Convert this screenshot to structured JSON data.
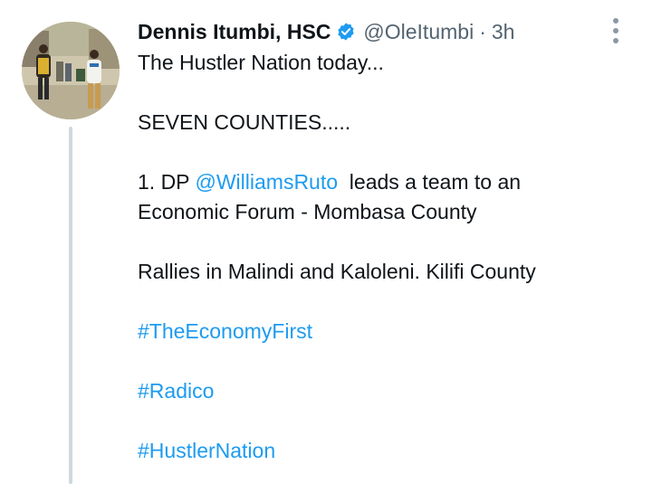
{
  "author": {
    "display_name": "Dennis Itumbi, HSC",
    "handle": "@OleItumbi",
    "separator": "·",
    "time": "3h",
    "verified": true
  },
  "text": {
    "line1": "The Hustler Nation today...",
    "line2": "SEVEN COUNTIES.....",
    "line3_prefix": "1. DP ",
    "line3_mention": "@WilliamsRuto",
    "line3_suffix": "  leads a team to an",
    "line4": "Economic Forum - Mombasa County",
    "line5": "Rallies in Malindi and Kaloleni. Kilifi County",
    "hashtag1": "#TheEconomyFirst",
    "hashtag2": "#Radico",
    "hashtag3": "#HustlerNation"
  },
  "colors": {
    "link": "#1d9bf0",
    "secondary_text": "#536471",
    "thread_line": "#cfd9de"
  },
  "icons": {
    "verified": "verified-badge-icon",
    "more": "more-vertical-icon"
  }
}
